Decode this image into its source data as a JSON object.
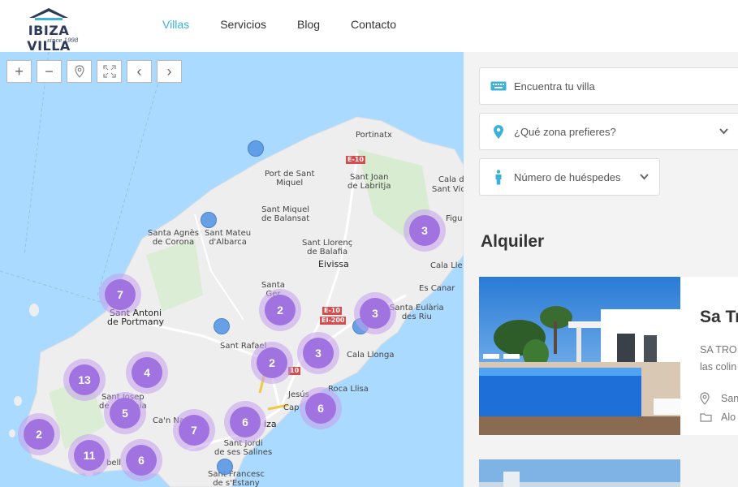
{
  "header": {
    "logo_text": "IBIZA VILLA",
    "logo_sub": "since 1998",
    "nav": [
      {
        "label": "Villas",
        "active": true
      },
      {
        "label": "Servicios",
        "active": false
      },
      {
        "label": "Blog",
        "active": false
      },
      {
        "label": "Contacto",
        "active": false
      }
    ]
  },
  "map": {
    "controls": [
      "zoom-in",
      "zoom-out",
      "location",
      "fullscreen",
      "previous",
      "next"
    ],
    "controls_glyphs": {
      "zoom_in": "+",
      "zoom_out": "−",
      "prev": "‹",
      "next": "›"
    },
    "places": {
      "portinatx": "Portinatx",
      "port_sant_miquel": "Port de Sant\nMiquel",
      "sant_joan": "Sant Joan\nde Labritja",
      "cala_de": "Cala de",
      "sant_vic": "Sant Vic",
      "sant_miquel_balansat": "Sant Miquel\nde Balansat",
      "santa_agnes": "Santa Agnès\nde Corona",
      "sant_mateu": "Sant Mateu\nd'Albarca",
      "figu": "Figu",
      "santa_eularia": "Santa Eulària\ndes Riu",
      "sant_llorenc": "Sant Llorenç\nde Balafia",
      "eivissa": "Eivissa",
      "cala_lle": "Cala Lle",
      "santa_ger": "Santa\nGer",
      "es_canar": "Es Canar",
      "sant_antoni": "Sant Antoni\nde Portmany",
      "sant_rafael": "Sant Rafael",
      "cala_llonga": "Cala Llonga",
      "roca_llisa": "Roca Llisa",
      "jesus": "Jesús",
      "cap": "Cap",
      "sant_josep": "Sant Josep\nde sa Talaia",
      "ca_na": "Ca'n Na",
      "iza": "iza",
      "sant_jordi": "Sant Jordi\nde ses Salines",
      "sant_francesc": "Sant Francesc\nde s'Estany",
      "bell": "bell"
    },
    "roads": [
      "E-10",
      "E-10",
      "EI-200",
      "10"
    ],
    "clusters": [
      3,
      7,
      2,
      3,
      2,
      3,
      13,
      4,
      5,
      6,
      7,
      6,
      2,
      11,
      6
    ]
  },
  "search": {
    "find_villa": "Encuentra tu villa",
    "zone_placeholder": "¿Qué zona prefieres?",
    "guests_placeholder": "Número de huéspedes"
  },
  "listing": {
    "section_title": "Alquiler",
    "card": {
      "title": "Sa Tr",
      "desc_line1": "SA TRO",
      "desc_line2": "las colin",
      "location": "San",
      "type": "Alo"
    }
  },
  "colors": {
    "accent": "#3bb3d9",
    "cluster": "#a073e0",
    "map_water": "#aadaff",
    "map_land": "#eeeeee"
  }
}
